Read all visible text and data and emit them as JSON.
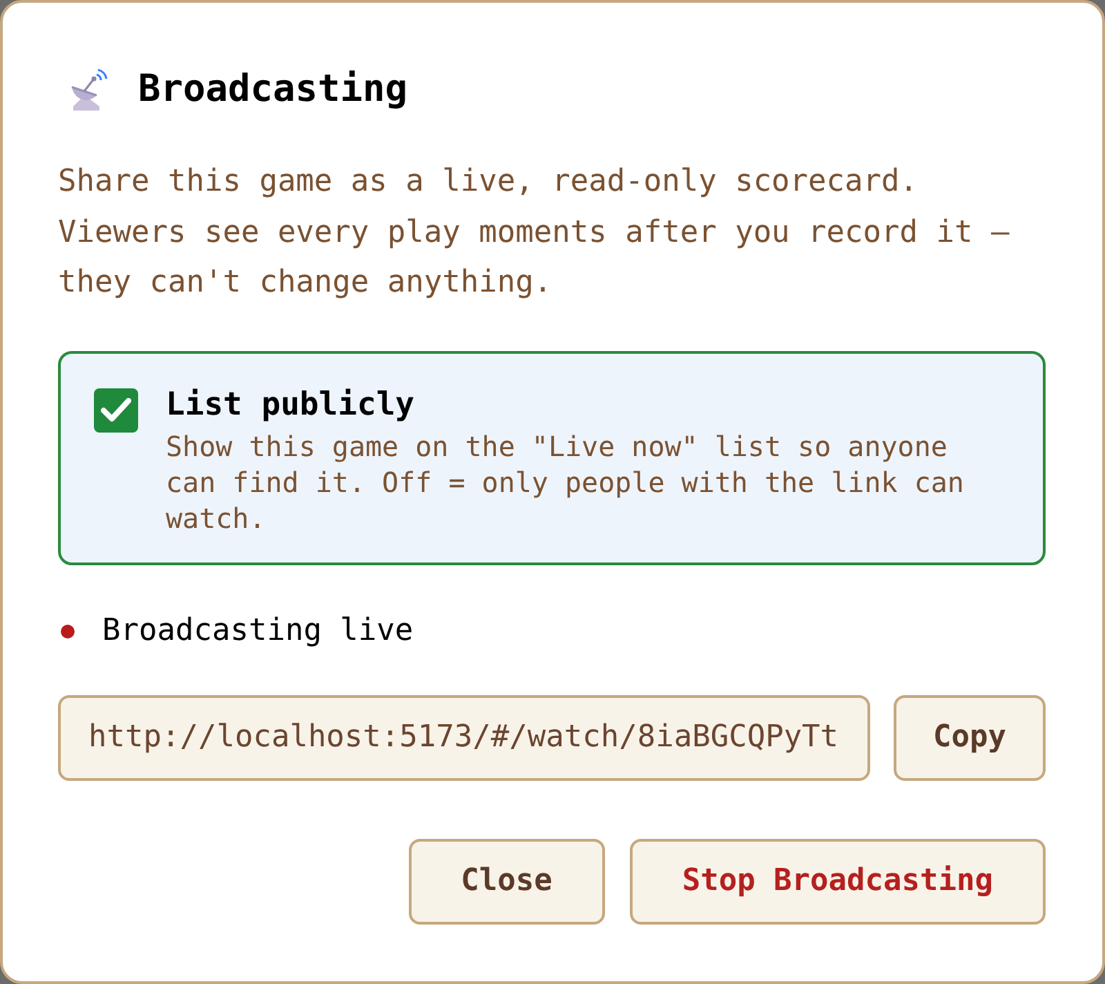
{
  "dialog": {
    "title": "Broadcasting",
    "description": "Share this game as a live, read-only scorecard. Viewers see every play moments after you record it — they can't change anything.",
    "list_publicly": {
      "label": "List publicly",
      "hint": "Show this game on the \"Live now\" list so anyone can find it. Off = only people with the link can watch.",
      "checked": true
    },
    "status": {
      "text": "Broadcasting live",
      "live": true
    },
    "share_link": {
      "value": "http://localhost:5173/#/watch/8iaBGCQPyTt",
      "copy_label": "Copy"
    },
    "buttons": [
      {
        "label": "Close",
        "kind": "secondary"
      },
      {
        "label": "Stop Broadcasting",
        "kind": "danger"
      }
    ]
  }
}
